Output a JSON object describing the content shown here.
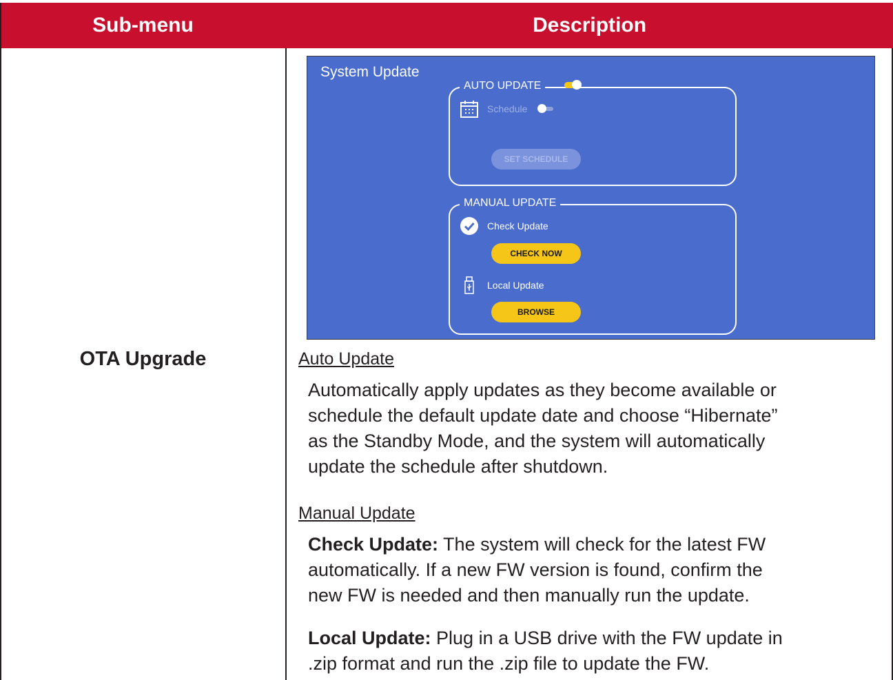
{
  "table": {
    "header": {
      "col1": "Sub-menu",
      "col2": "Description"
    },
    "submenu": "OTA Upgrade"
  },
  "screen": {
    "title": "System Update",
    "auto_update": {
      "label": "AUTO UPDATE",
      "toggle_on": true,
      "schedule_label": "Schedule",
      "schedule_on": false,
      "set_schedule_button": "SET SCHEDULE"
    },
    "manual_update": {
      "label": "MANUAL UPDATE",
      "check_update_label": "Check Update",
      "check_now_button": "CHECK NOW",
      "local_update_label": "Local Update",
      "browse_button": "BROWSE"
    }
  },
  "description": {
    "auto_heading": "Auto Update",
    "auto_text_1": "Automatically apply updates as they become available or",
    "auto_text_2": "schedule the default update date and choose “Hibernate”",
    "auto_text_3": "as the Standby Mode, and the system will automatically",
    "auto_text_4": "update the schedule after shutdown.",
    "manual_heading": "Manual Update",
    "check_label": "Check Update:",
    "check_text_1": " The system will check for the latest FW",
    "check_text_2": "automatically. If a new FW version is found, confirm the",
    "check_text_3": "new FW is needed and then manually run the update.",
    "local_label": "Local Update:",
    "local_text_1": " Plug in a USB drive with the FW update in",
    "local_text_2": ".zip format and run the .zip file to update the FW."
  },
  "colors": {
    "header_bg": "#c8102e",
    "panel_bg": "#4a6ccc",
    "button_yellow": "#f5c518"
  }
}
